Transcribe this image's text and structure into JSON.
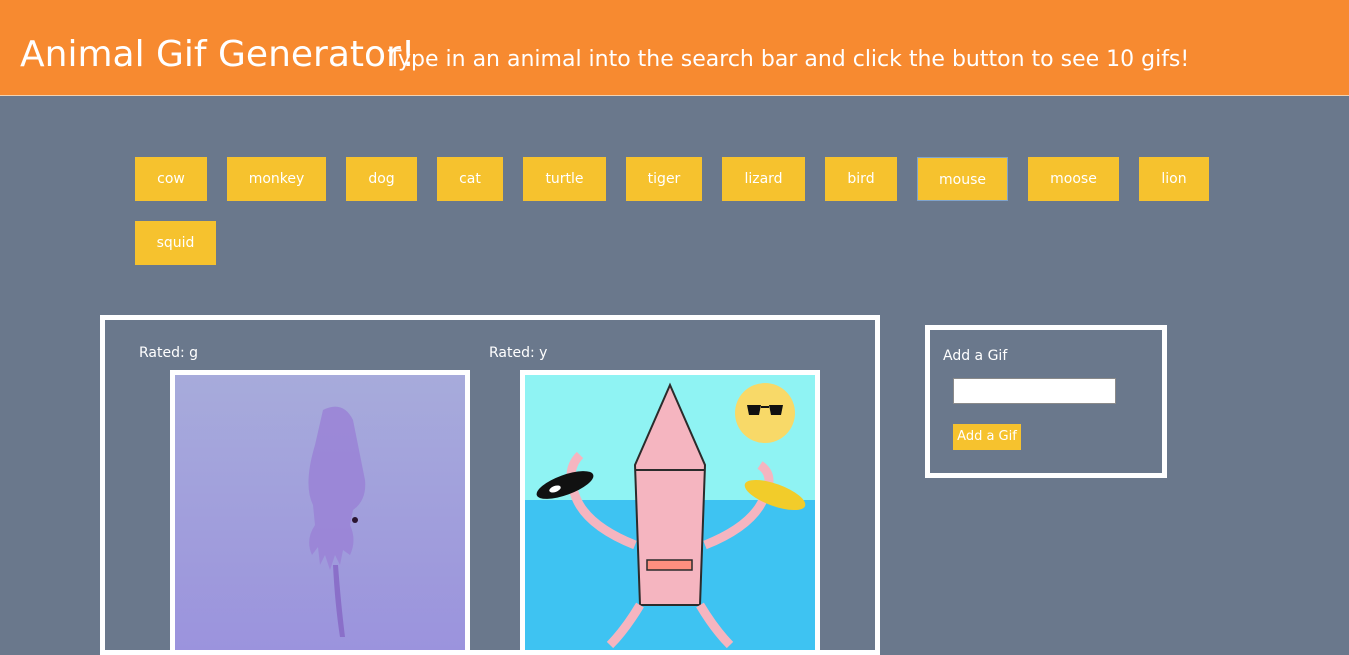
{
  "header": {
    "title": "Animal Gif Generator!",
    "subtitle": "Type in an animal into the search bar and click the button to see 10 gifs!"
  },
  "animal_buttons": [
    {
      "label": "cow"
    },
    {
      "label": "monkey"
    },
    {
      "label": "dog"
    },
    {
      "label": "cat"
    },
    {
      "label": "turtle"
    },
    {
      "label": "tiger"
    },
    {
      "label": "lizard"
    },
    {
      "label": "bird"
    },
    {
      "label": "mouse",
      "focused": true
    },
    {
      "label": "moose"
    },
    {
      "label": "lion"
    },
    {
      "label": "squid"
    }
  ],
  "results": {
    "gifs": [
      {
        "rating": "Rated: g",
        "icon": "purple-squid-image"
      },
      {
        "rating": "Rated: y",
        "icon": "cartoon-squid-image"
      }
    ]
  },
  "add_panel": {
    "label": "Add a Gif",
    "input_value": "",
    "button_label": "Add a Gif"
  },
  "colors": {
    "header_bg": "#f78a30",
    "page_bg": "#6a788c",
    "button_bg": "#f6c22e"
  }
}
